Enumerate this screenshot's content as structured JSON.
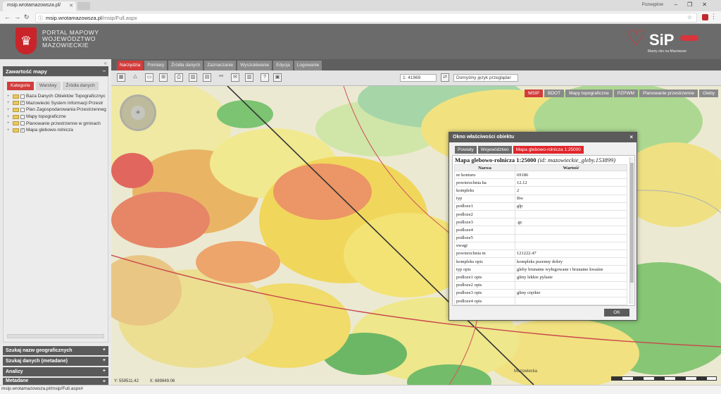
{
  "browser": {
    "tab_title": "msip.wrotamazowsza.pl/",
    "url_host": "msip.wrotamazowsza.pl",
    "url_path": "/msip/Full.aspx",
    "user_label": "Pozwęplow",
    "status_url": "msip.wrotamazowsza.pl/msip/Full.aspx#"
  },
  "header": {
    "portal_line1": "PORTAL MAPOWY",
    "portal_line2": "WOJEWÓDZTWO",
    "portal_line3": "MAZOWIECKIE",
    "logo_text": "SiP",
    "logo_sub": "Mamy oko na Mazowsze"
  },
  "left_panel": {
    "title": "Zawartość mapy",
    "tabs": [
      "Kategorie",
      "Warstwy",
      "Źródła danych"
    ],
    "layers": [
      "Baza Danych Obiektów Topograficznyc",
      "Mazowiecki System Informacji Przestr",
      "Plan Zagospodarowania Przestrzenneg",
      "Mapy topograficzne",
      "Planowanie przestrzenne w gminach",
      "Mapa glebowo-rolnicza"
    ],
    "accordion": [
      "Szukaj nazw geograficznych",
      "Szukaj danych (metadane)",
      "Analizy",
      "Metadane"
    ]
  },
  "toolbar": {
    "tabs": [
      "Narzędzia",
      "Pomiary",
      "Źródła danych",
      "Zaznaczanie",
      "Wyszukiwanie",
      "Edycja",
      "Logowanie"
    ],
    "scale_value": "1: 41969",
    "language": "Domyślny język przeglądar"
  },
  "map": {
    "services": [
      "MSIP",
      "BDOT",
      "Mapy topograficzne",
      "PZPWM",
      "Planowanie przestrzenne",
      "Gleby"
    ],
    "coord_y": "Y: 559511.42",
    "coord_x": "X: 689849.06",
    "town_label": "Mazowiecka"
  },
  "dialog": {
    "title": "Okno właściwości obiektu",
    "tabs": [
      "Powiaty",
      "Województwo",
      "Mapa glebowo-rolnicza 1:25000"
    ],
    "heading": "Mapa glebowo-rolnicza 1:25000",
    "heading_id": "(id: mazowieckie_gleby.153899)",
    "col_name": "Nazwa",
    "col_value": "Wartość",
    "rows": [
      [
        "nr konturu",
        "69186"
      ],
      [
        "powierzchnia ha",
        "12.12"
      ],
      [
        "kompleks",
        "2"
      ],
      [
        "typ",
        "Bw"
      ],
      [
        "podloze1",
        "glp"
      ],
      [
        "podloze2",
        ""
      ],
      [
        "podloze3",
        ".gc"
      ],
      [
        "podloze4",
        ""
      ],
      [
        "podloze5",
        ""
      ],
      [
        "uwagi",
        ""
      ],
      [
        "powierzchnia m",
        "121222.47"
      ],
      [
        "kompleks opis",
        "kompleks pszenny dobry"
      ],
      [
        "typ opis",
        "gleby brunatne wyługowane i brunatne kwaśne"
      ],
      [
        "podloze1 opis",
        "gliny lekkie pylaste"
      ],
      [
        "podloze2 opis",
        ""
      ],
      [
        "podloze3 opis",
        "gliny ciężkie"
      ],
      [
        "podloze4 opis",
        ""
      ]
    ],
    "ok_label": "OK"
  }
}
